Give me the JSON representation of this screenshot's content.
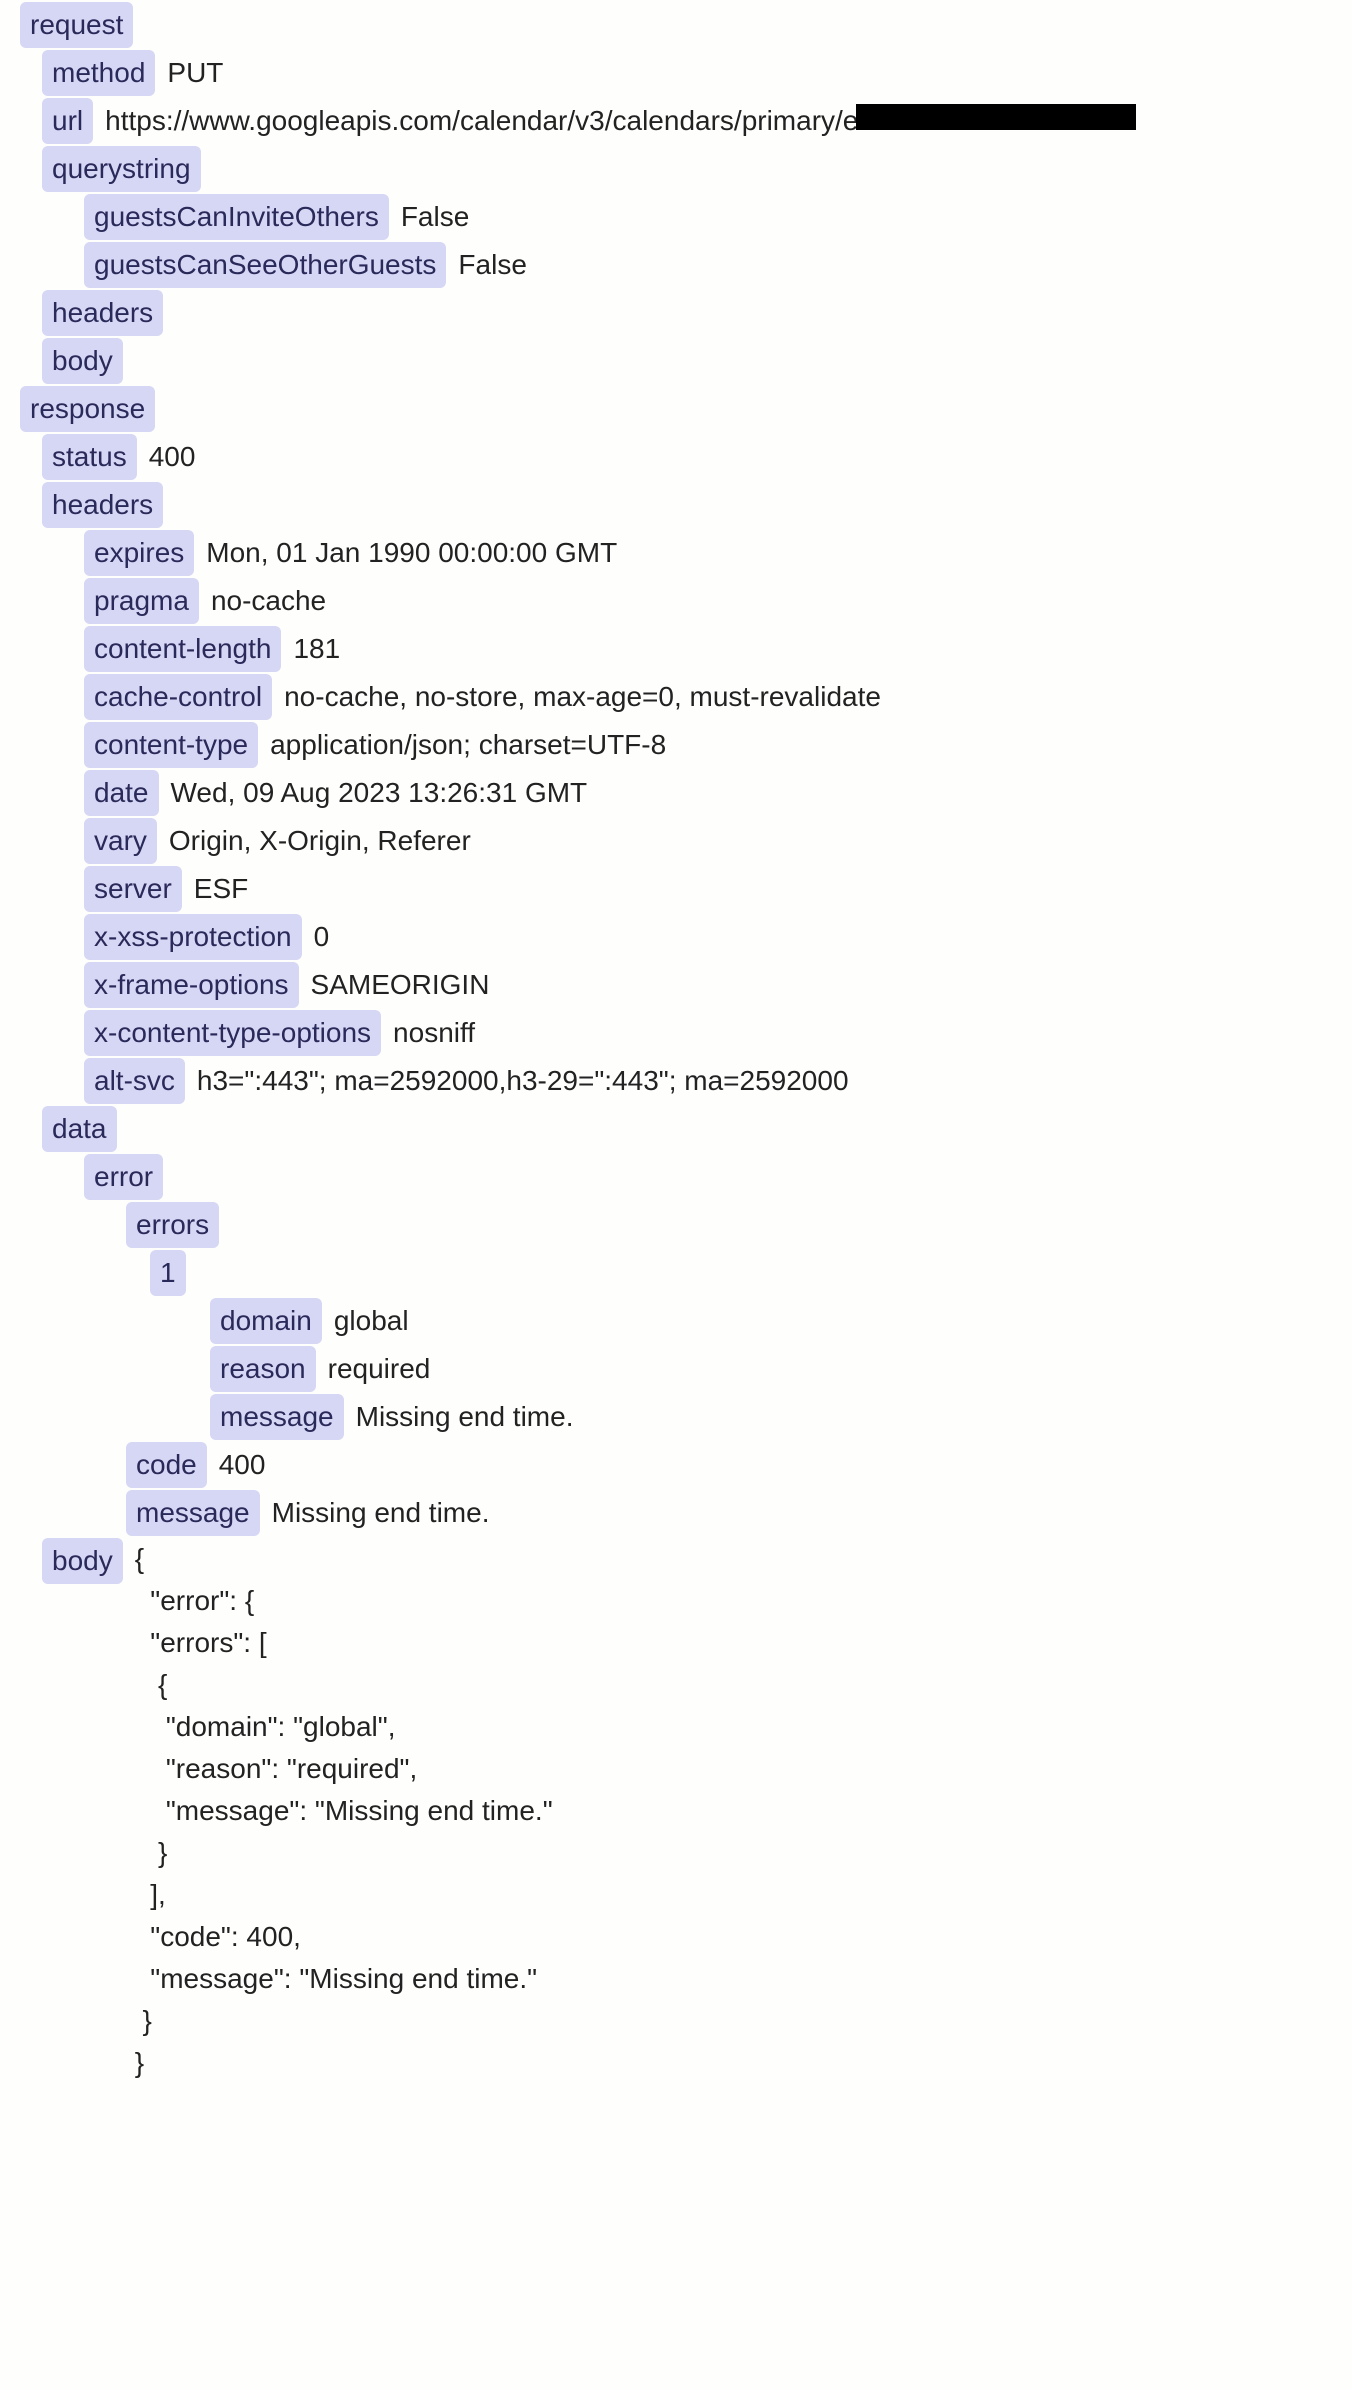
{
  "request": {
    "label": "request",
    "method": {
      "key": "method",
      "value": "PUT"
    },
    "url": {
      "key": "url",
      "value": "https://www.googleapis.com/calendar/v3/calendars/primary/e"
    },
    "querystring": {
      "label": "querystring",
      "guestsCanInviteOthers": {
        "key": "guestsCanInviteOthers",
        "value": "False"
      },
      "guestsCanSeeOtherGuests": {
        "key": "guestsCanSeeOtherGuests",
        "value": "False"
      }
    },
    "headers": {
      "label": "headers"
    },
    "body": {
      "label": "body"
    }
  },
  "response": {
    "label": "response",
    "status": {
      "key": "status",
      "value": "400"
    },
    "headers": {
      "label": "headers",
      "expires": {
        "key": "expires",
        "value": "Mon, 01 Jan 1990 00:00:00 GMT"
      },
      "pragma": {
        "key": "pragma",
        "value": "no-cache"
      },
      "content_length": {
        "key": "content-length",
        "value": "181"
      },
      "cache_control": {
        "key": "cache-control",
        "value": "no-cache, no-store, max-age=0, must-revalidate"
      },
      "content_type": {
        "key": "content-type",
        "value": "application/json; charset=UTF-8"
      },
      "date": {
        "key": "date",
        "value": "Wed, 09 Aug 2023 13:26:31 GMT"
      },
      "vary": {
        "key": "vary",
        "value": "Origin, X-Origin, Referer"
      },
      "server": {
        "key": "server",
        "value": "ESF"
      },
      "x_xss_protection": {
        "key": "x-xss-protection",
        "value": "0"
      },
      "x_frame_options": {
        "key": "x-frame-options",
        "value": "SAMEORIGIN"
      },
      "x_content_type_options": {
        "key": "x-content-type-options",
        "value": "nosniff"
      },
      "alt_svc": {
        "key": "alt-svc",
        "value": "h3=\":443\"; ma=2592000,h3-29=\":443\"; ma=2592000"
      }
    },
    "data": {
      "label": "data",
      "error": {
        "label": "error",
        "errors": {
          "label": "errors",
          "item1": {
            "label": "1",
            "domain": {
              "key": "domain",
              "value": "global"
            },
            "reason": {
              "key": "reason",
              "value": "required"
            },
            "message": {
              "key": "message",
              "value": "Missing end time."
            }
          }
        },
        "code": {
          "key": "code",
          "value": "400"
        },
        "message": {
          "key": "message",
          "value": "Missing end time."
        }
      }
    },
    "body": {
      "key": "body",
      "value": "{\n  \"error\": {\n  \"errors\": [\n   {\n    \"domain\": \"global\",\n    \"reason\": \"required\",\n    \"message\": \"Missing end time.\"\n   }\n  ],\n  \"code\": 400,\n  \"message\": \"Missing end time.\"\n }\n}"
    }
  }
}
